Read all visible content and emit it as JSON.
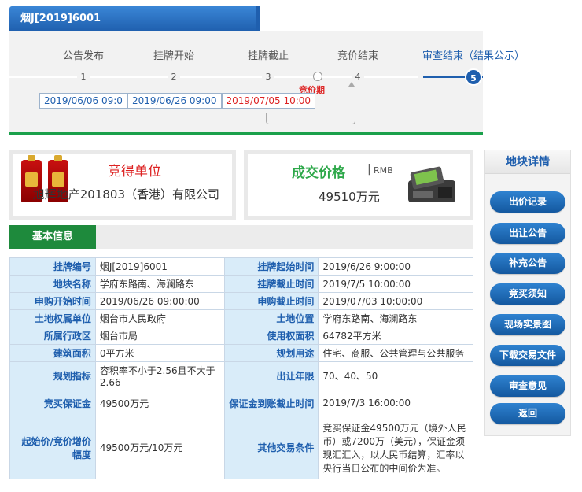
{
  "header": {
    "code": "烟J[2019]6001"
  },
  "progress": {
    "steps": [
      {
        "label": "公告发布",
        "num": "1"
      },
      {
        "label": "挂牌开始",
        "num": "2"
      },
      {
        "label": "挂牌截止",
        "num": "3"
      },
      {
        "label": "竞价结束",
        "num": "4"
      },
      {
        "label": "审查结束（结果公示）",
        "num": "5"
      }
    ],
    "current_step": 5,
    "bid_period_label": "竞价期",
    "dates": [
      "2019/06/06 09:0",
      "2019/06/26 09:00",
      "2019/07/05 10:00"
    ]
  },
  "winner": {
    "title": "竞得单位",
    "name": "旭辉地产201803（香港）有限公司"
  },
  "price": {
    "title": "成交价格",
    "separator": "|",
    "currency": "RMB",
    "value": "49510万元"
  },
  "basic": {
    "title": "基本信息",
    "rows": [
      {
        "l1": "挂牌编号",
        "v1": "烟J[2019]6001",
        "l2": "挂牌起始时间",
        "v2": "2019/6/26 9:00:00"
      },
      {
        "l1": "地块名称",
        "v1": "学府东路南、海澜路东",
        "l2": "挂牌截止时间",
        "v2": "2019/7/5 10:00:00"
      },
      {
        "l1": "申购开始时间",
        "v1": "2019/06/26 09:00:00",
        "l2": "申购截止时间",
        "v2": "2019/07/03 10:00:00"
      },
      {
        "l1": "土地权属单位",
        "v1": "烟台市人民政府",
        "l2": "土地位置",
        "v2": "学府东路南、海澜路东"
      },
      {
        "l1": "所属行政区",
        "v1": "烟台市局",
        "l2": "使用权面积",
        "v2": "64782平方米"
      },
      {
        "l1": "建筑面积",
        "v1": "0平方米",
        "l2": "规划用途",
        "v2": "住宅、商服、公共管理与公共服务"
      },
      {
        "l1": "规划指标",
        "v1": "容积率不小于2.56且不大于2.66",
        "l2": "出让年限",
        "v2": "70、40、50"
      },
      {
        "l1": "竞买保证金",
        "v1": "49500万元",
        "l2": "保证金到账截止时间",
        "v2": "2019/7/3 16:00:00"
      },
      {
        "l1": "起始价/竞价增价幅度",
        "v1": "49500万元/10万元",
        "l2": "其他交易条件",
        "v2": "竞买保证金49500万元（境外人民币）或7200万（美元），保证金须现汇汇入，以人民币结算，汇率以央行当日公布的中间价为准。"
      }
    ]
  },
  "side": {
    "title": "地块详情",
    "buttons": [
      "出价记录",
      "出让公告",
      "补充公告",
      "竞买须知",
      "现场实景图",
      "下载交易文件",
      "审查意见",
      "返回"
    ]
  },
  "colors": {
    "brand_blue": "#1f5fae",
    "green": "#1e8a3c",
    "red": "#dd2222"
  }
}
